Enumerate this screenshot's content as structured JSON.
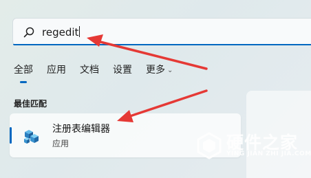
{
  "search": {
    "value": "regedit",
    "icon": "search-icon"
  },
  "tabs": [
    {
      "label": "全部",
      "active": true
    },
    {
      "label": "应用"
    },
    {
      "label": "文档"
    },
    {
      "label": "设置"
    },
    {
      "label": "更多"
    }
  ],
  "best_match": {
    "heading": "最佳匹配",
    "result": {
      "name": "注册表编辑器",
      "type": "应用",
      "icon": "registry-editor-icon"
    }
  },
  "watermark": {
    "text": "硬件之家",
    "subtext": "YING JIAN ZHI JIA.COM"
  },
  "colors": {
    "accent": "#0067c0",
    "annotation": "#e53935"
  }
}
